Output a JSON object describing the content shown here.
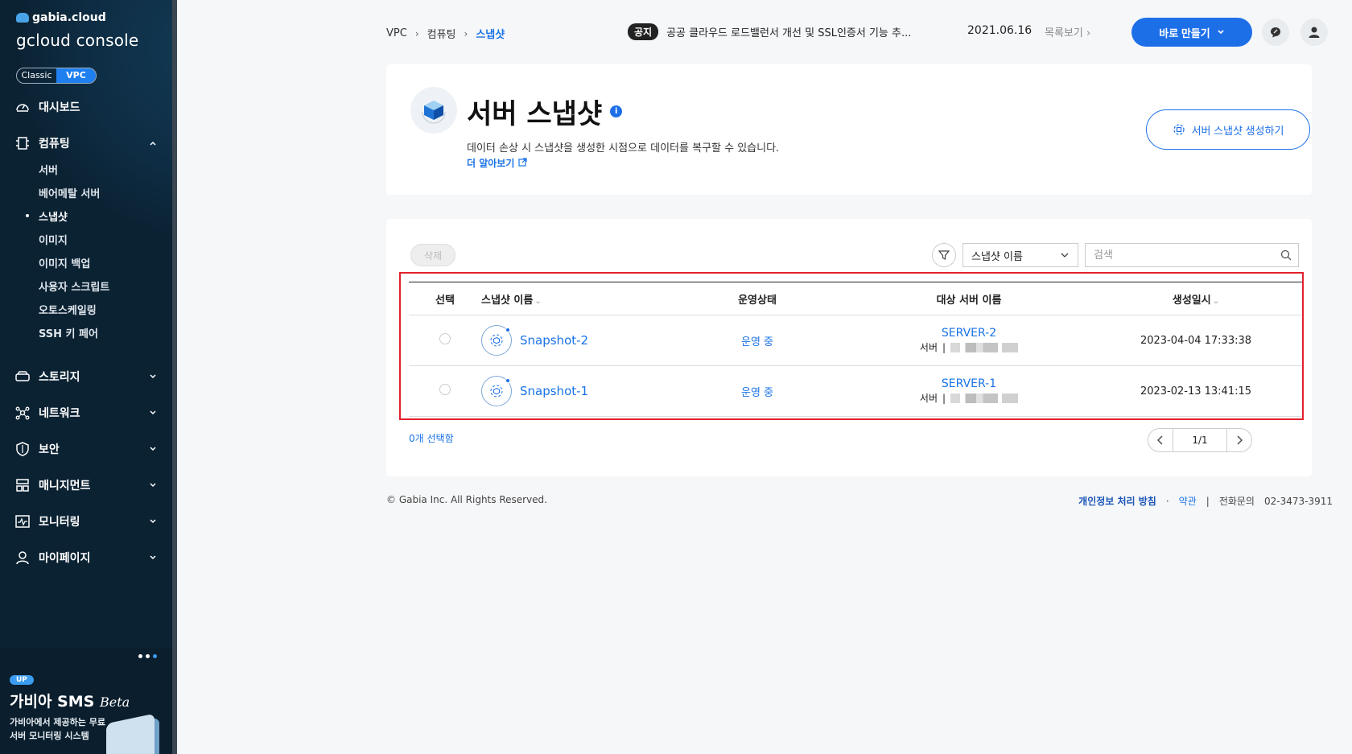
{
  "sidebar": {
    "brand_small": "gabia.cloud",
    "brand_big": "gcloud console",
    "mode_options": [
      "Classic",
      "VPC"
    ],
    "mode_selected": "VPC",
    "items": [
      {
        "label": "대시보드",
        "icon": "dashboard-icon"
      },
      {
        "label": "컴퓨팅",
        "icon": "compute-icon",
        "expanded": true
      },
      {
        "label": "스토리지",
        "icon": "storage-icon"
      },
      {
        "label": "네트워크",
        "icon": "network-icon"
      },
      {
        "label": "보안",
        "icon": "shield-icon"
      },
      {
        "label": "매니지먼트",
        "icon": "management-icon"
      },
      {
        "label": "모니터링",
        "icon": "monitoring-icon"
      },
      {
        "label": "마이페이지",
        "icon": "user-icon"
      }
    ],
    "compute_sub": [
      "서버",
      "베어메탈 서버",
      "스냅샷",
      "이미지",
      "이미지 백업",
      "사용자 스크립트",
      "오토스케일링",
      "SSH 키 페어"
    ],
    "compute_active": "스냅샷",
    "promo": {
      "badge": "UP",
      "title": "가비아 SMS",
      "title_suffix": "Beta",
      "text": "가비아에서 제공하는 무료 서버 모니터링 시스템"
    }
  },
  "topbar": {
    "breadcrumb": [
      "VPC",
      "컴퓨팅",
      "스냅샷"
    ],
    "notice_badge": "공지",
    "notice_text": "공공 클라우드 로드밸런서 개선 및 SSL인증서 기능 추...",
    "notice_date": "2021.06.16",
    "notice_more": "목록보기",
    "create_label": "바로 만들기"
  },
  "header": {
    "title": "서버 스냅샷",
    "description": "데이터 손상 시 스냅샷을 생성한 시점으로 데이터를 복구할 수 있습니다.",
    "learn_more": "더 알아보기",
    "create_snapshot_label": "서버 스냅샷 생성하기"
  },
  "list": {
    "delete_label": "삭제",
    "filter_select": "스냅샷 이름",
    "search_placeholder": "검색",
    "columns": [
      "선택",
      "스냅샷 이름",
      "운영상태",
      "대상 서버 이름",
      "생성일시"
    ],
    "rows": [
      {
        "name": "Snapshot-2",
        "status": "운영 중",
        "server": "SERVER-2",
        "server_type": "서버",
        "created": "2023-04-04 17:33:38"
      },
      {
        "name": "Snapshot-1",
        "status": "운영 중",
        "server": "SERVER-1",
        "server_type": "서버",
        "created": "2023-02-13 13:41:15"
      }
    ],
    "selected_count": "0개 선택함",
    "page": "1/1"
  },
  "footer": {
    "copyright": "© Gabia Inc. All Rights Reserved.",
    "privacy": "개인정보 처리 방침",
    "terms": "약관",
    "phone_label": "전화문의",
    "phone": "02-3473-3911"
  },
  "colors": {
    "accent": "#1d6fe8",
    "sidebar_bg": "#0b2233",
    "highlight": "#e3202b"
  }
}
